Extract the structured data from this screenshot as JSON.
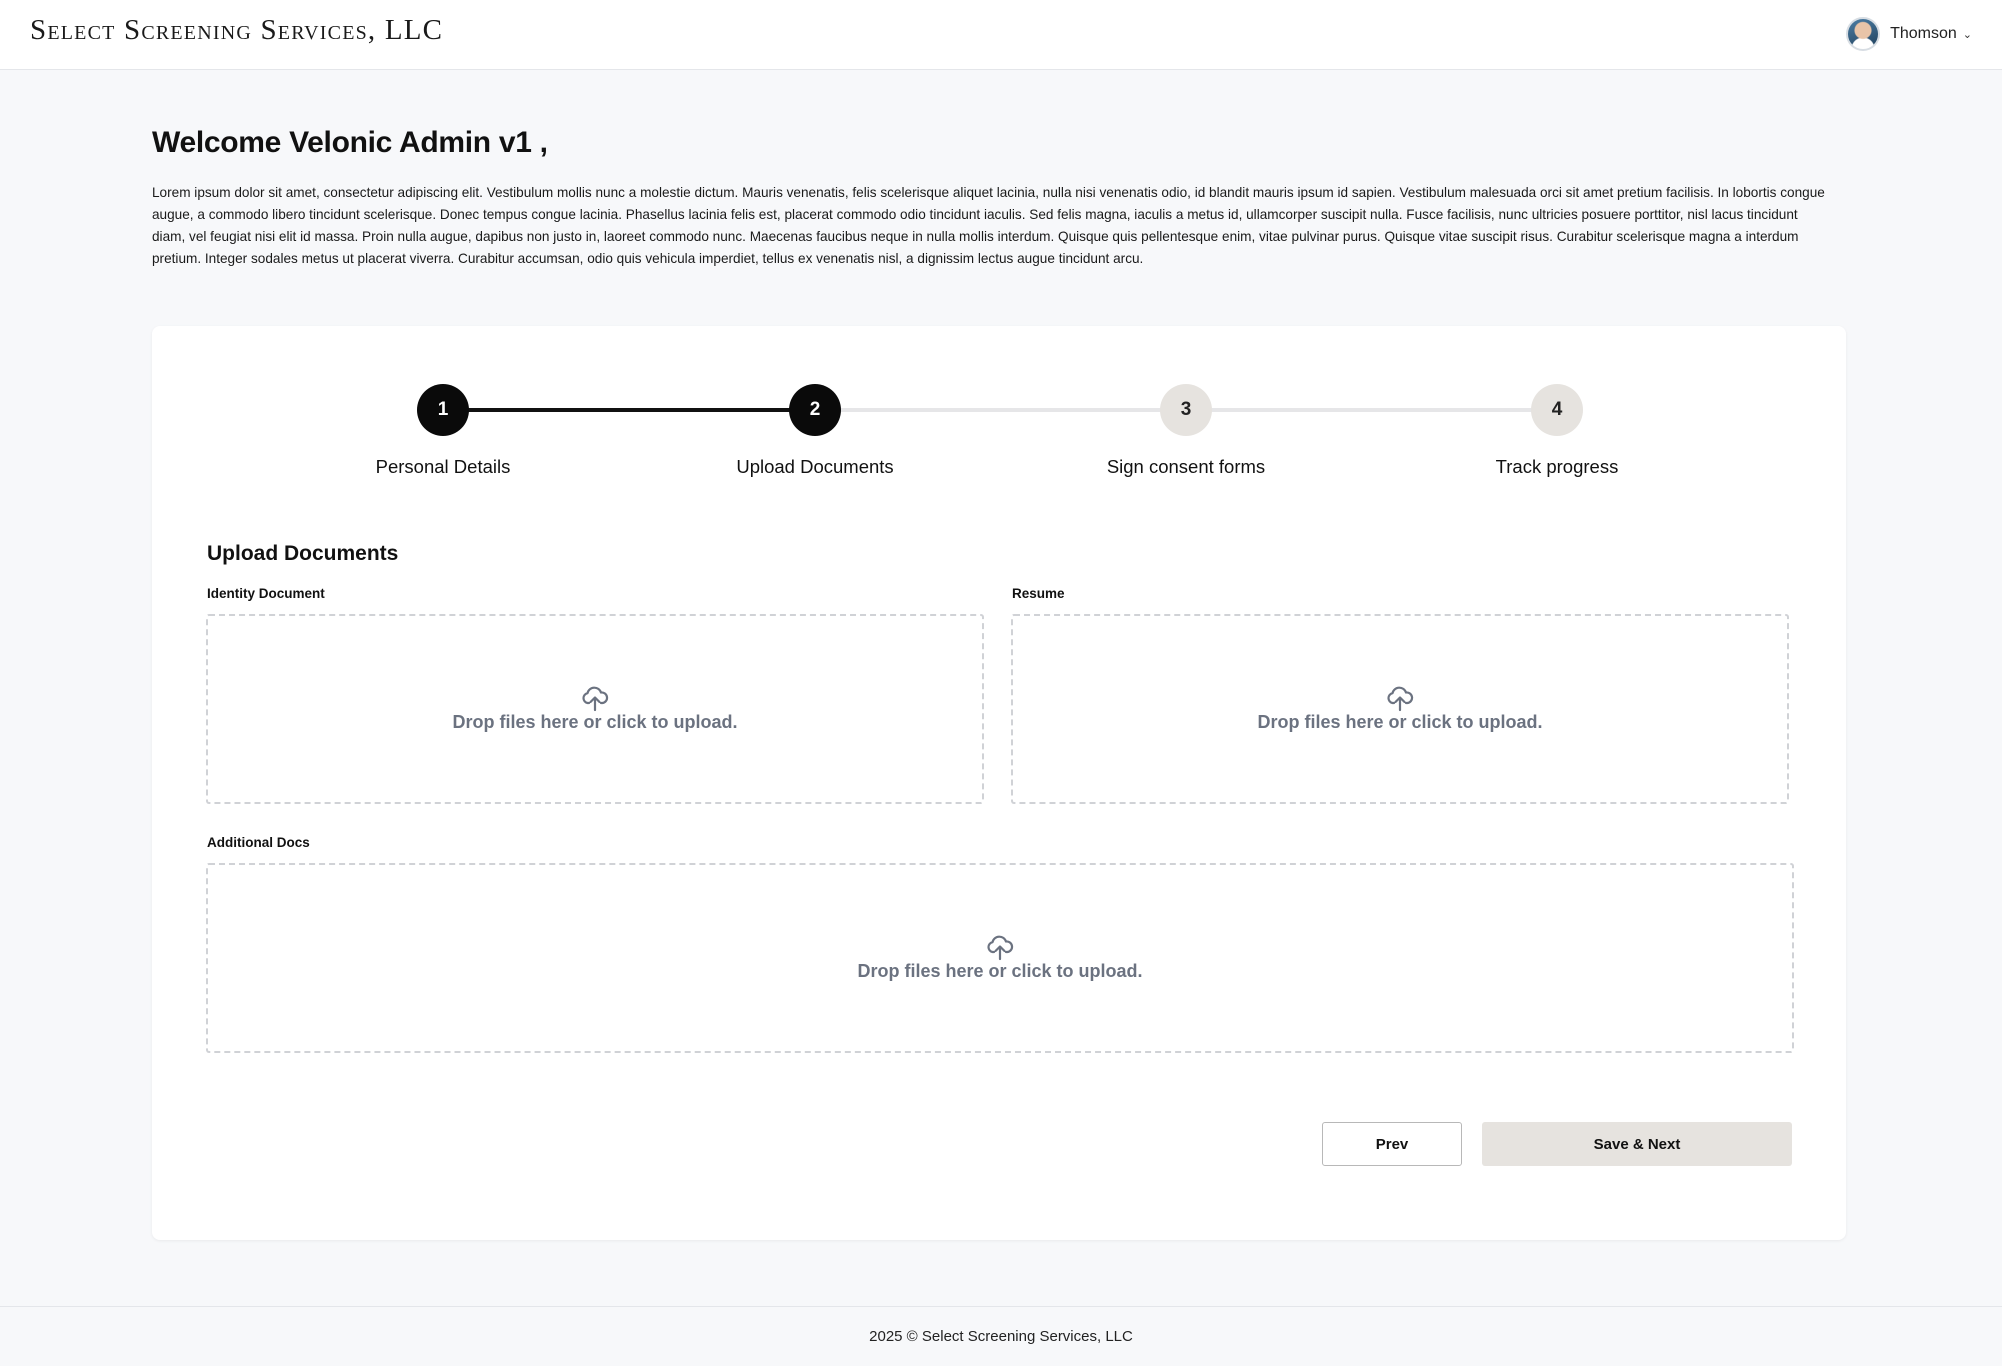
{
  "header": {
    "brand": "Select Screening Services, LLC",
    "user_name": "Thomson",
    "user_menu_icon": "chevron-down-icon"
  },
  "welcome": {
    "title": "Welcome Velonic Admin v1 ,",
    "text": "Lorem ipsum dolor sit amet, consectetur adipiscing elit. Vestibulum mollis nunc a molestie dictum. Mauris venenatis, felis scelerisque aliquet lacinia, nulla nisi venenatis odio, id blandit mauris ipsum id sapien. Vestibulum malesuada orci sit amet pretium facilisis. In lobortis congue augue, a commodo libero tincidunt scelerisque. Donec tempus congue lacinia. Phasellus lacinia felis est, placerat commodo odio tincidunt iaculis. Sed felis magna, iaculis a metus id, ullamcorper suscipit nulla. Fusce facilisis, nunc ultricies posuere porttitor, nisl lacus tincidunt diam, vel feugiat nisi elit id massa. Proin nulla augue, dapibus non justo in, laoreet commodo nunc. Maecenas faucibus neque in nulla mollis interdum. Quisque quis pellentesque enim, vitae pulvinar purus. Quisque vitae suscipit risus. Curabitur scelerisque magna a interdum pretium. Integer sodales metus ut placerat viverra. Curabitur accumsan, odio quis vehicula imperdiet, tellus ex venenatis nisl, a dignissim lectus augue tincidunt arcu."
  },
  "stepper": {
    "current_step": 2,
    "steps": [
      {
        "number": "1",
        "label": "Personal Details",
        "state": "active"
      },
      {
        "number": "2",
        "label": "Upload Documents",
        "state": "active"
      },
      {
        "number": "3",
        "label": "Sign consent forms",
        "state": "inactive"
      },
      {
        "number": "4",
        "label": "Track progress",
        "state": "inactive"
      }
    ]
  },
  "form": {
    "section_title": "Upload Documents",
    "identity_label": "Identity Document",
    "resume_label": "Resume",
    "additional_label": "Additional Docs",
    "dropzone_text": "Drop files here or click to upload.",
    "dropzone_icon": "cloud-upload-icon"
  },
  "buttons": {
    "prev": "Prev",
    "save_next": "Save & Next"
  },
  "footer": {
    "text": "2025 © Select Screening Services, LLC"
  },
  "colors": {
    "active_step": "#0a0a0a",
    "inactive_step": "#e6e3df",
    "primary_button": "#e6e3df",
    "page_background": "#f7f8fa",
    "dropzone_text": "#6b7280"
  }
}
